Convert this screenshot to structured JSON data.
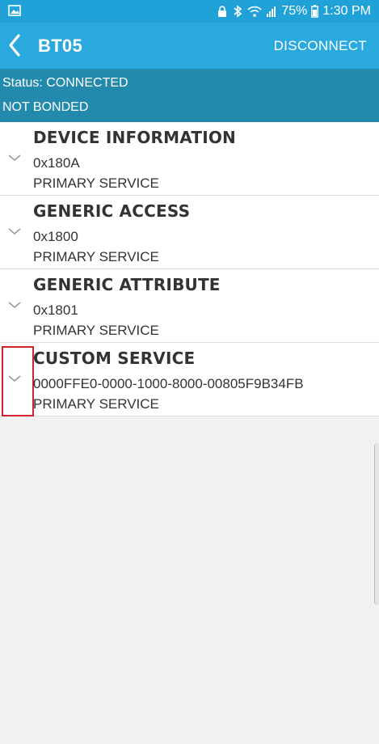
{
  "status_bar": {
    "battery": "75%",
    "time": "1:30 PM",
    "icons": [
      "gallery-icon",
      "lock-icon",
      "bluetooth-icon",
      "wifi-icon",
      "signal-icon",
      "battery-icon"
    ]
  },
  "app_bar": {
    "title": "BT05",
    "disconnect_label": "DISCONNECT",
    "back_icon": "chevron-left-icon"
  },
  "status": {
    "connection": "Status: CONNECTED",
    "bond": "NOT BONDED"
  },
  "services": [
    {
      "name": "DEVICE INFORMATION",
      "uuid": "0x180A",
      "type": "PRIMARY SERVICE"
    },
    {
      "name": "GENERIC ACCESS",
      "uuid": "0x1800",
      "type": "PRIMARY SERVICE"
    },
    {
      "name": "GENERIC ATTRIBUTE",
      "uuid": "0x1801",
      "type": "PRIMARY SERVICE"
    },
    {
      "name": "CUSTOM SERVICE",
      "uuid": "0000FFE0-0000-1000-8000-00805F9B34FB",
      "type": "PRIMARY SERVICE"
    }
  ],
  "colors": {
    "status_bar": "#20a2d9",
    "app_bar": "#2aa9df",
    "status_panel": "#2389ad",
    "highlight": "#d2232a"
  }
}
